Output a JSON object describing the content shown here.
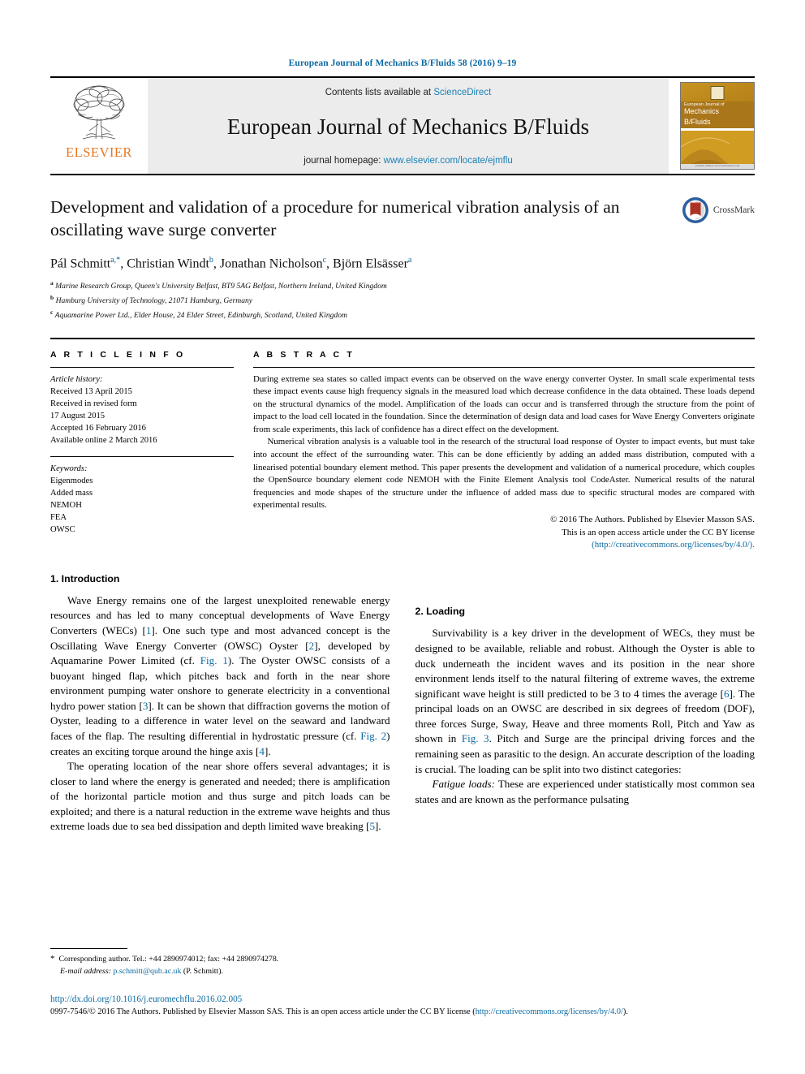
{
  "running_head": "European Journal of Mechanics B/Fluids 58 (2016) 9–19",
  "masthead": {
    "publisher_name": "ELSEVIER",
    "contents_prefix": "Contents lists available at ",
    "contents_link": "ScienceDirect",
    "journal_title": "European Journal of Mechanics B/Fluids",
    "homepage_prefix": "journal homepage: ",
    "homepage_url": "www.elsevier.com/locate/ejmflu",
    "cover": {
      "line1": "European Journal of",
      "line2": "Mechanics",
      "line3": "B/Fluids",
      "footer": "available online at www.sciencedirect.com"
    }
  },
  "article": {
    "title": "Development and validation of a procedure for numerical vibration analysis of an oscillating wave surge converter",
    "crossmark_label": "CrossMark",
    "authors": [
      {
        "name": "Pál Schmitt",
        "marks": "a,*"
      },
      {
        "name": "Christian Windt",
        "marks": "b"
      },
      {
        "name": "Jonathan Nicholson",
        "marks": "c"
      },
      {
        "name": "Björn Elsässer",
        "marks": "a"
      }
    ],
    "affiliations": [
      {
        "mark": "a",
        "text": "Marine Research Group, Queen's University Belfast, BT9 5AG Belfast, Northern Ireland, United Kingdom"
      },
      {
        "mark": "b",
        "text": "Hamburg University of Technology, 21071 Hamburg, Germany"
      },
      {
        "mark": "c",
        "text": "Aquamarine Power Ltd., Elder House, 24 Elder Street, Edinburgh, Scotland, United Kingdom"
      }
    ]
  },
  "article_info": {
    "heading": "A R T I C L E   I N F O",
    "history_label": "Article history:",
    "history": [
      "Received 13 April 2015",
      "Received in revised form",
      "17 August 2015",
      "Accepted 16 February 2016",
      "Available online 2 March 2016"
    ],
    "keywords_label": "Keywords:",
    "keywords": [
      "Eigenmodes",
      "Added mass",
      "NEMOH",
      "FEA",
      "OWSC"
    ]
  },
  "abstract": {
    "heading": "A B S T R A C T",
    "paragraph1": "During extreme sea states so called impact events can be observed on the wave energy converter Oyster. In small scale experimental tests these impact events cause high frequency signals in the measured load which decrease confidence in the data obtained. These loads depend on the structural dynamics of the model. Amplification of the loads can occur and is transferred through the structure from the point of impact to the load cell located in the foundation. Since the determination of design data and load cases for Wave Energy Converters originate from scale experiments, this lack of confidence has a direct effect on the development.",
    "paragraph2": "Numerical vibration analysis is a valuable tool in the research of the structural load response of Oyster to impact events, but must take into account the effect of the surrounding water. This can be done efficiently by adding an added mass distribution, computed with a linearised potential boundary element method. This paper presents the development and validation of a numerical procedure, which couples the OpenSource boundary element code NEMOH with the Finite Element Analysis tool CodeAster. Numerical results of the natural frequencies and mode shapes of the structure under the influence of added mass due to specific structural modes are compared with experimental results.",
    "copyright_line1": "© 2016 The Authors. Published by Elsevier Masson SAS.",
    "copyright_line2": "This is an open access article under the CC BY license",
    "copyright_link": "(http://creativecommons.org/licenses/by/4.0/)."
  },
  "body": {
    "section1_title": "1. Introduction",
    "section1_p1_a": "Wave Energy remains one of the largest unexploited renewable energy resources and has led to many conceptual developments of Wave Energy Converters (WECs) [",
    "section1_p1_ref1": "1",
    "section1_p1_b": "]. One such type and most advanced concept is the Oscillating Wave Energy Converter (OWSC) Oyster [",
    "section1_p1_ref2": "2",
    "section1_p1_c": "], developed by Aquamarine Power Limited (cf. ",
    "section1_p1_figref1": "Fig. 1",
    "section1_p1_d": "). The Oyster OWSC consists of a buoyant hinged flap, which pitches back and forth in the near shore environment pumping water onshore to generate electricity in a conventional hydro power station [",
    "section1_p1_ref3": "3",
    "section1_p1_e": "]. It can be shown that diffraction governs the motion of Oyster, leading to a difference in water level on the seaward and landward faces of the flap. The resulting differential in hydrostatic pressure (cf. ",
    "section1_p1_figref2": "Fig. 2",
    "section1_p1_f": ") creates an exciting torque around the hinge axis [",
    "section1_p1_ref4": "4",
    "section1_p1_g": "].",
    "section1_p2_a": "The operating location of the near shore offers several advantages; it is closer to land where the energy is generated and needed; there is amplification of the horizontal particle motion and thus surge and pitch loads can be exploited; and there is a natural reduction in the extreme wave heights and thus extreme loads due to sea bed dissipation and depth limited wave breaking [",
    "section1_p2_ref5": "5",
    "section1_p2_b": "].",
    "section2_title": "2. Loading",
    "section2_p1_a": "Survivability is a key driver in the development of WECs, they must be designed to be available, reliable and robust. Although the Oyster is able to duck underneath the incident waves and its position in the near shore environment lends itself to the natural filtering of extreme waves, the extreme significant wave height is still predicted to be 3 to 4 times the average [",
    "section2_p1_ref6": "6",
    "section2_p1_b": "]. The principal loads on an OWSC are described in six degrees of freedom (DOF), three forces Surge, Sway, Heave and three moments Roll, Pitch and Yaw as shown in ",
    "section2_p1_figref3": "Fig. 3",
    "section2_p1_c": ". Pitch and Surge are the principal driving forces and the remaining seen as parasitic to the design. An accurate description of the loading is crucial. The loading can be split into two distinct categories:",
    "section2_p2_label": "Fatigue loads:",
    "section2_p2_text": " These are experienced under statistically most common sea states and are known as the performance pulsating"
  },
  "footnote": {
    "star": "*",
    "corresponding": "Corresponding author. Tel.: +44 2890974012; fax: +44 2890974278.",
    "email_label": "E-mail address:",
    "email": "p.schmitt@qub.ac.uk",
    "email_attrib": "(P. Schmitt)."
  },
  "footer": {
    "doi": "http://dx.doi.org/10.1016/j.euromechflu.2016.02.005",
    "issn_a": "0997-7546/© 2016 The Authors. Published by Elsevier Masson SAS. This is an open access article under the CC BY license (",
    "issn_link": "http://creativecommons.org/licenses/by/4.0/",
    "issn_b": ")."
  },
  "colors": {
    "link": "#0b6aa2",
    "elsevier_orange": "#E87722",
    "masthead_bg": "#ececec"
  }
}
